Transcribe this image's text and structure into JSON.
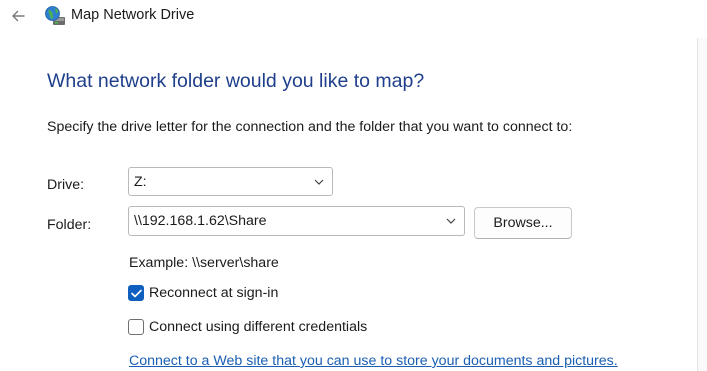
{
  "window": {
    "title": "Map Network Drive",
    "back_icon": "arrow-left-icon",
    "app_icon": "network-drive-globe-icon"
  },
  "content": {
    "heading": "What network folder would you like to map?",
    "instructions": "Specify the drive letter for the connection and the folder that you want to connect to:"
  },
  "form": {
    "drive_label": "Drive:",
    "drive_value": "Z:",
    "folder_label": "Folder:",
    "folder_value": "\\\\192.168.1.62\\Share",
    "browse_label": "Browse...",
    "example_text": "Example: \\\\server\\share",
    "reconnect_label": "Reconnect at sign-in",
    "reconnect_checked": true,
    "credentials_label": "Connect using different credentials",
    "credentials_checked": false
  },
  "link": {
    "text": "Connect to a Web site that you can use to store your documents and pictures."
  },
  "colors": {
    "heading": "#1f3f8c",
    "link": "#1a5fb4",
    "checkbox_accent": "#0f5fc0"
  }
}
